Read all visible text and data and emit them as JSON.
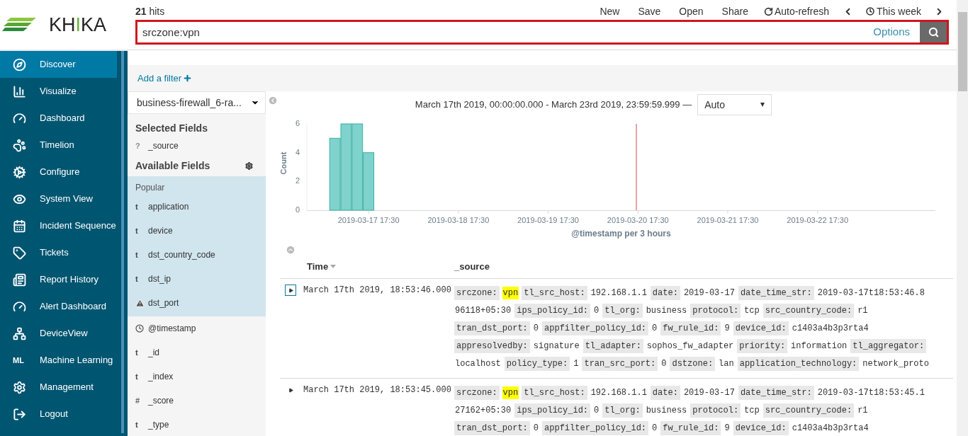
{
  "logo": {
    "text": "KHIKA"
  },
  "hits": {
    "count": "21",
    "label": "hits"
  },
  "toolbar": [
    {
      "kind": "text",
      "label": "New"
    },
    {
      "kind": "text",
      "label": "Save"
    },
    {
      "kind": "text",
      "label": "Open"
    },
    {
      "kind": "text",
      "label": "Share"
    },
    {
      "kind": "refresh",
      "label": "Auto-refresh"
    },
    {
      "kind": "prev"
    },
    {
      "kind": "time",
      "label": "This week"
    },
    {
      "kind": "next"
    }
  ],
  "search": {
    "value": "srczone:vpn",
    "options": "Options"
  },
  "filter": {
    "label": "Add a filter"
  },
  "sidebar": {
    "items": [
      {
        "label": "Discover",
        "selected": true
      },
      {
        "label": "Visualize",
        "selected": false
      },
      {
        "label": "Dashboard",
        "selected": false
      },
      {
        "label": "Timelion",
        "selected": false
      },
      {
        "label": "Configure",
        "selected": false
      },
      {
        "label": "System View",
        "selected": false
      },
      {
        "label": "Incident Sequence",
        "selected": false
      },
      {
        "label": "Tickets",
        "selected": false
      },
      {
        "label": "Report History",
        "selected": false
      },
      {
        "label": "Alert Dashboard",
        "selected": false
      },
      {
        "label": "DeviceView",
        "selected": false
      },
      {
        "label": "Machine Learning",
        "selected": false,
        "badge": "ML"
      },
      {
        "label": "Management",
        "selected": false
      },
      {
        "label": "Logout",
        "selected": false
      }
    ]
  },
  "fields": {
    "index_pattern": "business-firewall_6-ra...",
    "selected_title": "Selected Fields",
    "selected": [
      {
        "kind": "unknown",
        "symbol": "?",
        "name": "_source"
      }
    ],
    "available_title": "Available Fields",
    "popular_title": "Popular",
    "popular": [
      {
        "kind": "string",
        "symbol": "t",
        "name": "application"
      },
      {
        "kind": "string",
        "symbol": "t",
        "name": "device"
      },
      {
        "kind": "string",
        "symbol": "t",
        "name": "dst_country_code"
      },
      {
        "kind": "string",
        "symbol": "t",
        "name": "dst_ip"
      },
      {
        "kind": "conflict",
        "name": "dst_port"
      }
    ],
    "other": [
      {
        "kind": "date",
        "name": "@timestamp"
      },
      {
        "kind": "string",
        "symbol": "t",
        "name": "_id"
      },
      {
        "kind": "string",
        "symbol": "t",
        "name": "_index"
      },
      {
        "kind": "number",
        "symbol": "#",
        "name": "_score"
      },
      {
        "kind": "string",
        "symbol": "t",
        "name": "_type"
      }
    ]
  },
  "histogram": {
    "range": "March 17th 2019, 00:00:00.000 - March 23rd 2019, 23:59:59.999 —",
    "interval": "Auto",
    "chart_data": {
      "type": "bar",
      "xlabel": "@timestamp per 3 hours",
      "ylabel": "Count",
      "categories": [
        null,
        null,
        null,
        null,
        null,
        "2019-03-17 17:30",
        null,
        null,
        null,
        null,
        null,
        null,
        null,
        "2019-03-18 17:30",
        null,
        null,
        null,
        null,
        null,
        null,
        null,
        "2019-03-19 17:30",
        null,
        null,
        null,
        null,
        null,
        null,
        null,
        "2019-03-20 17:30",
        null,
        null,
        null,
        null,
        null,
        null,
        null,
        "2019-03-21 17:30",
        null,
        null,
        null,
        null,
        null,
        null,
        null,
        "2019-03-22 17:30",
        null,
        null,
        null,
        null,
        null,
        null,
        null,
        null,
        null,
        null
      ],
      "values": [
        null,
        null,
        5,
        6,
        6,
        4,
        null,
        null,
        null,
        null,
        null,
        null,
        null,
        null,
        null,
        null,
        null,
        null,
        null,
        null,
        null,
        null,
        null,
        null,
        null,
        null,
        null,
        null,
        null,
        null,
        null,
        null,
        null,
        null,
        null,
        null,
        null,
        null,
        null,
        null,
        null,
        null,
        null,
        null,
        null,
        null,
        null,
        null,
        null,
        null,
        null,
        null,
        null,
        null,
        null,
        null
      ],
      "ylim": [
        0,
        6
      ],
      "yticks": [
        0,
        2,
        4,
        6
      ]
    }
  },
  "table": {
    "columns": [
      {
        "label": "Time",
        "sortable": true
      },
      {
        "label": "_source",
        "sortable": false
      }
    ],
    "rows": [
      {
        "expanded": false,
        "focused": true,
        "time": "March 17th 2019, 18:53:46.000",
        "lines": [
          [
            {
              "k": "srczone:",
              "v": "vpn",
              "highlight": true
            },
            {
              "k": "tl_src_host:",
              "v": "192.168.1.1",
              "highlight": false
            },
            {
              "k": "date:",
              "v": "2019-03-17",
              "highlight": false
            },
            {
              "k": "date_time_str:",
              "v": "2019-03-17t18:53:46.8",
              "highlight": false
            }
          ],
          [
            {
              "v": "96118+05:30",
              "highlight": false
            },
            {
              "k": "ips_policy_id:",
              "v": "0",
              "highlight": false
            },
            {
              "k": "tl_org:",
              "v": "business",
              "highlight": false
            },
            {
              "k": "protocol:",
              "v": "tcp",
              "highlight": false
            },
            {
              "k": "src_country_code:",
              "v": "r1",
              "highlight": false
            }
          ],
          [
            {
              "k": "tran_dst_port:",
              "v": "0",
              "highlight": false
            },
            {
              "k": "appfilter_policy_id:",
              "v": "0",
              "highlight": false
            },
            {
              "k": "fw_rule_id:",
              "v": "9",
              "highlight": false
            },
            {
              "k": "device_id:",
              "v": "c1403a4b3p3rta4",
              "highlight": false
            }
          ],
          [
            {
              "k": "appresolvedby:",
              "v": "signature",
              "highlight": false
            },
            {
              "k": "tl_adapter:",
              "v": "sophos_fw_adapter",
              "highlight": false
            },
            {
              "k": "priority:",
              "v": "information",
              "highlight": false
            },
            {
              "k": "tl_aggregator:"
            }
          ],
          [
            {
              "v": "localhost",
              "highlight": false
            },
            {
              "k": "policy_type:",
              "v": "1",
              "highlight": false
            },
            {
              "k": "tran_src_port:",
              "v": "0",
              "highlight": false
            },
            {
              "k": "dstzone:",
              "v": "lan",
              "highlight": false
            },
            {
              "k": "application_technology:",
              "v": "network_proto",
              "highlight": false
            }
          ]
        ]
      },
      {
        "expanded": false,
        "focused": false,
        "time": "March 17th 2019, 18:53:45.000",
        "lines": [
          [
            {
              "k": "srczone:",
              "v": "vpn",
              "highlight": true
            },
            {
              "k": "tl_src_host:",
              "v": "192.168.1.1",
              "highlight": false
            },
            {
              "k": "date:",
              "v": "2019-03-17",
              "highlight": false
            },
            {
              "k": "date_time_str:",
              "v": "2019-03-17t18:53:45.1",
              "highlight": false
            }
          ],
          [
            {
              "v": "27162+05:30",
              "highlight": false
            },
            {
              "k": "ips_policy_id:",
              "v": "0",
              "highlight": false
            },
            {
              "k": "tl_org:",
              "v": "business",
              "highlight": false
            },
            {
              "k": "protocol:",
              "v": "tcp",
              "highlight": false
            },
            {
              "k": "src_country_code:",
              "v": "r1",
              "highlight": false
            }
          ],
          [
            {
              "k": "tran_dst_port:",
              "v": "0",
              "highlight": false
            },
            {
              "k": "appfilter_policy_id:",
              "v": "0",
              "highlight": false
            },
            {
              "k": "fw_rule_id:",
              "v": "9",
              "highlight": false
            },
            {
              "k": "device_id:",
              "v": "c1403a4b3p3rta4",
              "highlight": false
            }
          ]
        ]
      }
    ]
  }
}
